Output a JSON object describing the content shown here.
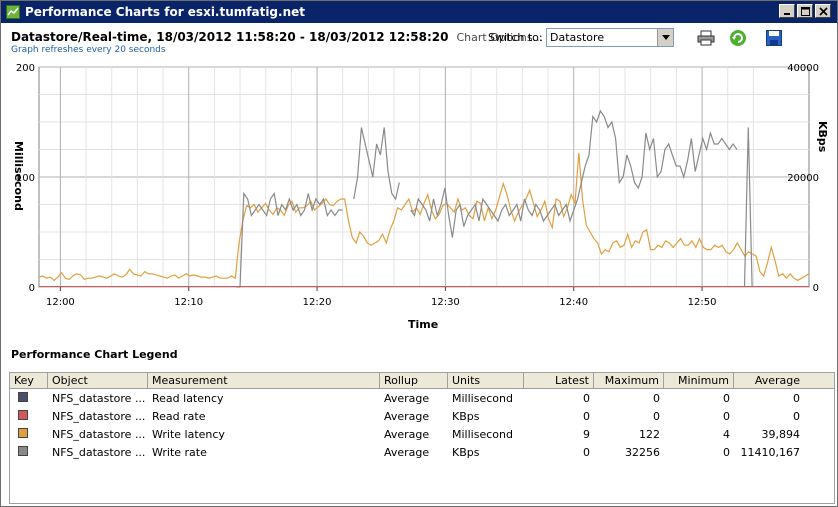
{
  "window": {
    "title": "Performance Charts for esxi.tumfatig.net"
  },
  "header": {
    "title": "Datastore/Real-time, 18/03/2012 11:58:20 - 18/03/2012 12:58:20",
    "chart_options_label": "Chart Options...",
    "switch_label": "Switch to:",
    "switch_value": "Datastore",
    "refresh_note": "Graph refreshes every 20 seconds"
  },
  "chart_data": {
    "type": "line",
    "xlabel": "Time",
    "ylabel_left": "Millisecond",
    "ylabel_right": "KBps",
    "x_ticks": [
      "12:00",
      "12:10",
      "12:20",
      "12:30",
      "12:40",
      "12:50"
    ],
    "y_left_ticks": [
      "0",
      "100",
      "200"
    ],
    "y_right_ticks": [
      "0",
      "20000",
      "40000"
    ],
    "ylim_left": [
      0,
      200
    ],
    "ylim_right": [
      0,
      40000
    ],
    "grid": true,
    "series": [
      {
        "name": "Write latency",
        "axis": "left",
        "color": "#e0a040",
        "values": [
          9,
          10,
          8,
          9,
          6,
          9,
          13,
          8,
          7,
          10,
          12,
          11,
          7,
          8,
          8,
          9,
          10,
          9,
          8,
          10,
          12,
          10,
          9,
          11,
          16,
          12,
          11,
          10,
          14,
          12,
          12,
          11,
          10,
          9,
          8,
          10,
          11,
          8,
          10,
          12,
          10,
          11,
          10,
          9,
          9,
          8,
          9,
          10,
          8,
          8,
          8,
          10,
          8,
          40,
          60,
          74,
          72,
          75,
          68,
          72,
          76,
          70,
          66,
          72,
          70,
          65,
          74,
          78,
          68,
          72,
          72,
          74,
          78,
          70,
          73,
          76,
          80,
          75,
          74,
          78,
          80,
          80,
          60,
          45,
          40,
          50,
          46,
          40,
          38,
          40,
          42,
          48,
          40,
          52,
          60,
          72,
          70,
          75,
          80,
          68,
          72,
          66,
          76,
          84,
          70,
          62,
          66,
          74,
          76,
          72,
          68,
          80,
          70,
          72,
          65,
          62,
          78,
          76,
          60,
          72,
          62,
          70,
          82,
          94,
          84,
          70,
          60,
          68,
          74,
          80,
          88,
          76,
          64,
          70,
          78,
          62,
          54,
          80,
          78,
          64,
          72,
          84,
          76,
          122,
          80,
          56,
          50,
          44,
          40,
          30,
          34,
          32,
          40,
          42,
          36,
          38,
          48,
          36,
          42,
          40,
          50,
          52,
          34,
          34,
          38,
          36,
          42,
          40,
          36,
          40,
          44,
          38,
          38,
          42,
          36,
          44,
          36,
          34,
          34,
          38,
          36,
          38,
          32,
          30,
          34,
          40,
          34,
          28,
          32,
          30,
          28,
          14,
          10,
          22,
          36,
          24,
          10,
          12,
          8,
          12,
          8,
          6,
          8,
          10,
          12
        ]
      },
      {
        "name": "Write rate",
        "axis": "right",
        "color": "#8a8a8a",
        "values": [
          null,
          null,
          null,
          null,
          null,
          null,
          null,
          null,
          null,
          null,
          null,
          null,
          null,
          null,
          null,
          null,
          null,
          null,
          null,
          null,
          null,
          null,
          null,
          null,
          null,
          null,
          null,
          null,
          null,
          null,
          null,
          null,
          null,
          null,
          null,
          null,
          null,
          null,
          null,
          null,
          null,
          null,
          null,
          null,
          null,
          null,
          null,
          null,
          null,
          null,
          null,
          null,
          0,
          0,
          17000,
          16000,
          13000,
          14000,
          15000,
          14000,
          13000,
          16000,
          17000,
          13000,
          15000,
          14000,
          16000,
          14000,
          15000,
          13000,
          14000,
          17000,
          14000,
          16000,
          15000,
          16000,
          13000,
          14000,
          13000,
          14000,
          14000,
          null,
          null,
          16000,
          20000,
          29000,
          26000,
          23000,
          20000,
          26000,
          24000,
          29000,
          21000,
          17000,
          16000,
          19000,
          null,
          null,
          14000,
          13000,
          16000,
          15000,
          14000,
          12000,
          16000,
          13000,
          15000,
          18000,
          13000,
          9000,
          14000,
          15000,
          11000,
          13000,
          14000,
          15000,
          12000,
          16000,
          15000,
          14000,
          13000,
          12000,
          14000,
          15000,
          13000,
          14000,
          15000,
          12000,
          16000,
          14000,
          13000,
          15000,
          14000,
          12000,
          13000,
          14000,
          15000,
          13000,
          14000,
          15000,
          12000,
          14000,
          16000,
          19000,
          22000,
          24000,
          31000,
          30000,
          32000,
          31000,
          29000,
          30000,
          27000,
          19000,
          20000,
          24000,
          22000,
          19000,
          18000,
          20000,
          28000,
          25000,
          27000,
          20000,
          21000,
          25000,
          26000,
          24000,
          22000,
          22000,
          20000,
          23000,
          27000,
          21000,
          24000,
          27000,
          25000,
          28000,
          26000,
          26000,
          27000,
          26000,
          25000,
          26000,
          25000,
          null,
          0,
          29000,
          0,
          null,
          null,
          null,
          null,
          null,
          null,
          null,
          null,
          null,
          null,
          null,
          null,
          null,
          null,
          null
        ]
      },
      {
        "name": "Read latency",
        "axis": "left",
        "color": "#4a4e6a",
        "values": [
          0,
          0
        ]
      },
      {
        "name": "Read rate",
        "axis": "right",
        "color": "#d05a5a",
        "values": [
          0,
          0
        ]
      }
    ]
  },
  "legend": {
    "title": "Performance Chart Legend",
    "columns": {
      "key": "Key",
      "object": "Object",
      "measurement": "Measurement",
      "rollup": "Rollup",
      "units": "Units",
      "latest": "Latest",
      "maximum": "Maximum",
      "minimum": "Minimum",
      "average": "Average"
    },
    "rows": [
      {
        "color": "#4a4e6a",
        "object": "NFS_datastore ...",
        "measurement": "Read latency",
        "rollup": "Average",
        "units": "Millisecond",
        "latest": "0",
        "maximum": "0",
        "minimum": "0",
        "average": "0"
      },
      {
        "color": "#d05a5a",
        "object": "NFS_datastore ...",
        "measurement": "Read rate",
        "rollup": "Average",
        "units": "KBps",
        "latest": "0",
        "maximum": "0",
        "minimum": "0",
        "average": "0"
      },
      {
        "color": "#e0a040",
        "object": "NFS_datastore ...",
        "measurement": "Write latency",
        "rollup": "Average",
        "units": "Millisecond",
        "latest": "9",
        "maximum": "122",
        "minimum": "4",
        "average": "39,894"
      },
      {
        "color": "#8a8a8a",
        "object": "NFS_datastore ...",
        "measurement": "Write rate",
        "rollup": "Average",
        "units": "KBps",
        "latest": "0",
        "maximum": "32256",
        "minimum": "0",
        "average": "11410,167"
      }
    ]
  },
  "icons": {
    "app": "vsphere-chart-icon",
    "print": "printer-icon",
    "refresh": "refresh-icon",
    "save": "save-icon"
  }
}
